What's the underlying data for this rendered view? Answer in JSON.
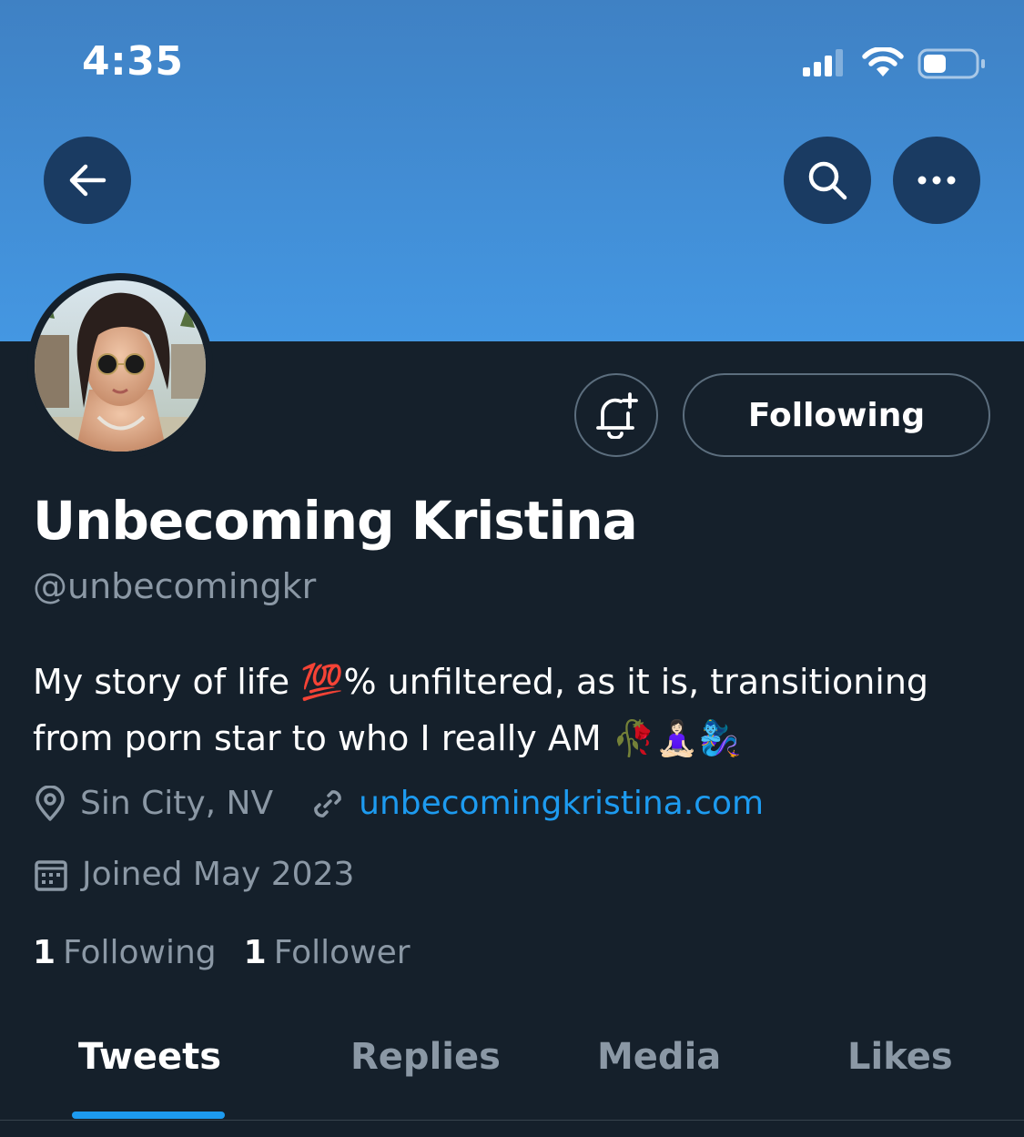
{
  "status_bar": {
    "time": "4:35"
  },
  "nav": {
    "back_icon": "arrow-left-icon",
    "search_icon": "search-icon",
    "more_icon": "more-dots-icon"
  },
  "profile": {
    "display_name": "Unbecoming Kristina",
    "handle": "@unbecomingkr",
    "bio_line1": "My story of life 💯% unfiltered, as it is, transitioning",
    "bio_line2": "from porn star to who I really AM 🥀🧘🏻‍♀️🧞‍♀️",
    "location": "Sin City, NV",
    "website": "unbecomingkristina.com",
    "joined": "Joined May 2023",
    "following_count": "1",
    "following_label": "Following",
    "followers_count": "1",
    "followers_label": "Follower"
  },
  "actions": {
    "notify_icon": "bell-plus-icon",
    "follow_label": "Following"
  },
  "tabs": [
    {
      "label": "Tweets",
      "active": true
    },
    {
      "label": "Replies",
      "active": false
    },
    {
      "label": "Media",
      "active": false
    },
    {
      "label": "Likes",
      "active": false
    }
  ],
  "colors": {
    "background": "#15202b",
    "accent": "#1d9bf0",
    "secondary_text": "#8b98a5",
    "banner": "#4497e2"
  }
}
